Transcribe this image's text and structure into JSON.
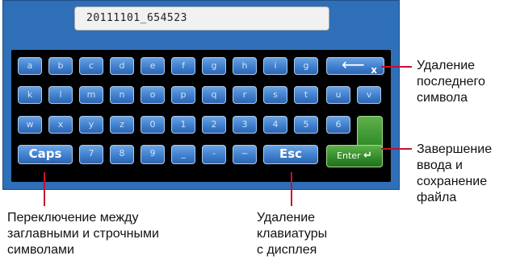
{
  "filename": {
    "value": "20111101_654523"
  },
  "keys": {
    "row1": [
      "a",
      "b",
      "c",
      "d",
      "e",
      "f",
      "g",
      "h",
      "i",
      "g"
    ],
    "backspace_label": "x",
    "row2": [
      "k",
      "l",
      "m",
      "n",
      "o",
      "p",
      "q",
      "r",
      "s",
      "t",
      "u",
      "v"
    ],
    "row3": [
      "w",
      "x",
      "y",
      "z",
      "0",
      "1",
      "2",
      "3",
      "4",
      "5",
      "6"
    ],
    "caps": "Caps",
    "row4": [
      "7",
      "8",
      "9",
      "_",
      "-",
      "~"
    ],
    "esc": "Esc",
    "enter": "Enter"
  },
  "callouts": {
    "backspace": "Удаление\nпоследнего\nсимвола",
    "enter": "Завершение\nввода и\nсохранение\nфайла",
    "caps": "Переключение между\nзаглавными и строчными\nсимволами",
    "esc": "Удаление\nклавиатуры\nс дисплея"
  },
  "colors": {
    "panel": "#2e6fb7",
    "key": "#3f7fcf",
    "enter": "#2f8a28",
    "callout_line": "#c8102e"
  }
}
